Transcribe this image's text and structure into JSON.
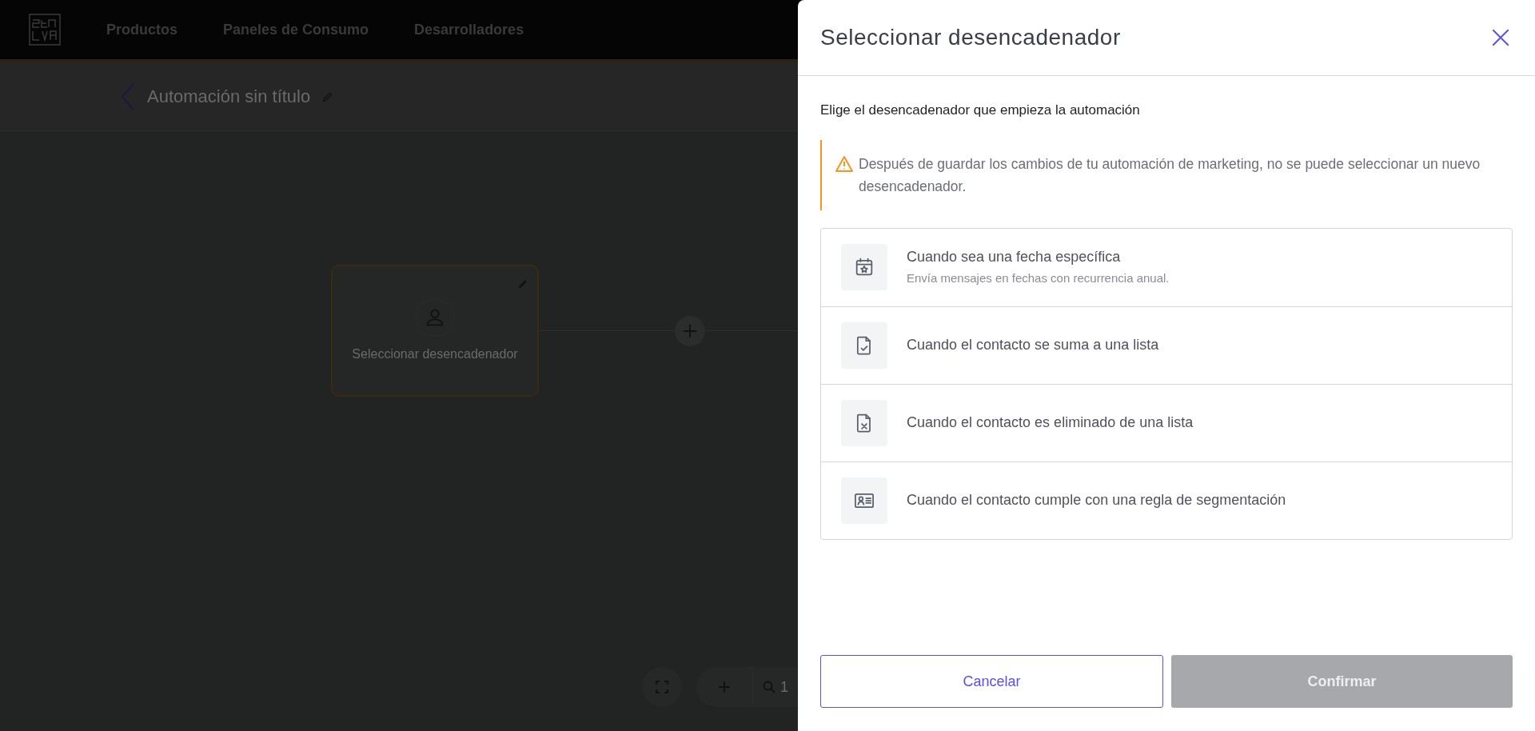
{
  "nav": {
    "items": [
      "Productos",
      "Paneles de Consumo",
      "Desarrolladores"
    ]
  },
  "subheader": {
    "title": "Automación sin título"
  },
  "canvas": {
    "node": {
      "label": "Seleccionar desencadenador"
    },
    "zoom_text": "1"
  },
  "drawer": {
    "title": "Seleccionar desencadenador",
    "subtitle": "Elige el desencadenador que empieza la automación",
    "warning": "Después de guardar los cambios de tu automación de marketing, no se puede seleccionar un nuevo desencadenador.",
    "triggers": [
      {
        "kind": "date",
        "title": "Cuando sea una fecha específica",
        "description": "Envía mensajes en fechas con recurrencia anual."
      },
      {
        "kind": "list-add",
        "title": "Cuando el contacto se suma a una lista"
      },
      {
        "kind": "list-remove",
        "title": "Cuando el contacto es eliminado de una lista"
      },
      {
        "kind": "segment",
        "title": "Cuando el contacto cumple con una regla de segmentación"
      }
    ],
    "buttons": [
      {
        "label": "Cancelar",
        "disabled": false
      },
      {
        "label": "Confirmar",
        "disabled": true
      }
    ]
  }
}
